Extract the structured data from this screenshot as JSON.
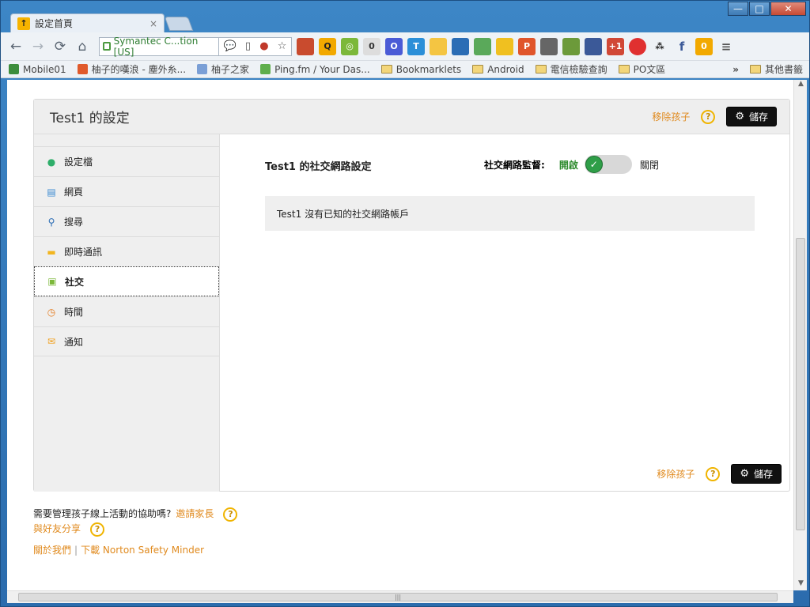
{
  "browser": {
    "tab_title": "設定首頁",
    "tab_close": "×",
    "address": "Symantec C...tion [US]",
    "window_buttons": [
      "—",
      "□",
      "✕"
    ]
  },
  "toolbar": {
    "extension_badge_count": "0",
    "extension_badge_f": "f",
    "extension_badge_zero": "0"
  },
  "bookmarks": [
    {
      "label": "Mobile01",
      "kind": "site",
      "color": "#3c8d3c"
    },
    {
      "label": "柚子的嘆浪 - 塵外糸...",
      "kind": "site",
      "color": "#e05a2b"
    },
    {
      "label": "柚子之家",
      "kind": "site",
      "color": "#7a9fd6"
    },
    {
      "label": "Ping.fm / Your Das...",
      "kind": "site",
      "color": "#5fae4c"
    },
    {
      "label": "Bookmarklets",
      "kind": "folder"
    },
    {
      "label": "Android",
      "kind": "folder"
    },
    {
      "label": "電信檢驗查詢",
      "kind": "folder"
    },
    {
      "label": "PO文區",
      "kind": "folder"
    }
  ],
  "bookmarks_more": "»",
  "bookmarks_other": "其他書籤",
  "panel": {
    "title": "Test1 的設定",
    "remove_label": "移除孩子",
    "help": "?",
    "save_label": "儲存"
  },
  "sidebar": {
    "items": [
      {
        "label": "設定檔",
        "icon": "person-icon",
        "color": "#2fae6a"
      },
      {
        "label": "網頁",
        "icon": "browser-window-icon",
        "color": "#3a8ad1"
      },
      {
        "label": "搜尋",
        "icon": "magnifier-icon",
        "color": "#2b6db5"
      },
      {
        "label": "即時通訊",
        "icon": "chat-icon",
        "color": "#f2b51f"
      },
      {
        "label": "社交",
        "icon": "social-contact-icon",
        "color": "#7cb83a",
        "active": true
      },
      {
        "label": "時間",
        "icon": "stopwatch-icon",
        "color": "#e57b1e"
      },
      {
        "label": "通知",
        "icon": "envelope-icon",
        "color": "#f0a01e"
      }
    ]
  },
  "content": {
    "title": "Test1 的社交網路設定",
    "monitor_label": "社交網路監督:",
    "on_label": "開啟",
    "off_label": "關閉",
    "notice": "Test1 沒有已知的社交網路帳戶"
  },
  "footer": {
    "question": "需要管理孩子線上活動的協助嗎?",
    "invite_parent": "邀請家長",
    "share_friends": "與好友分享",
    "about": "關於我們",
    "separator": "|",
    "download": "下載 Norton Safety Minder"
  },
  "colors": {
    "accent_orange": "#e08a1e",
    "toggle_on": "#2f9e48",
    "help_yellow": "#f0b400"
  }
}
